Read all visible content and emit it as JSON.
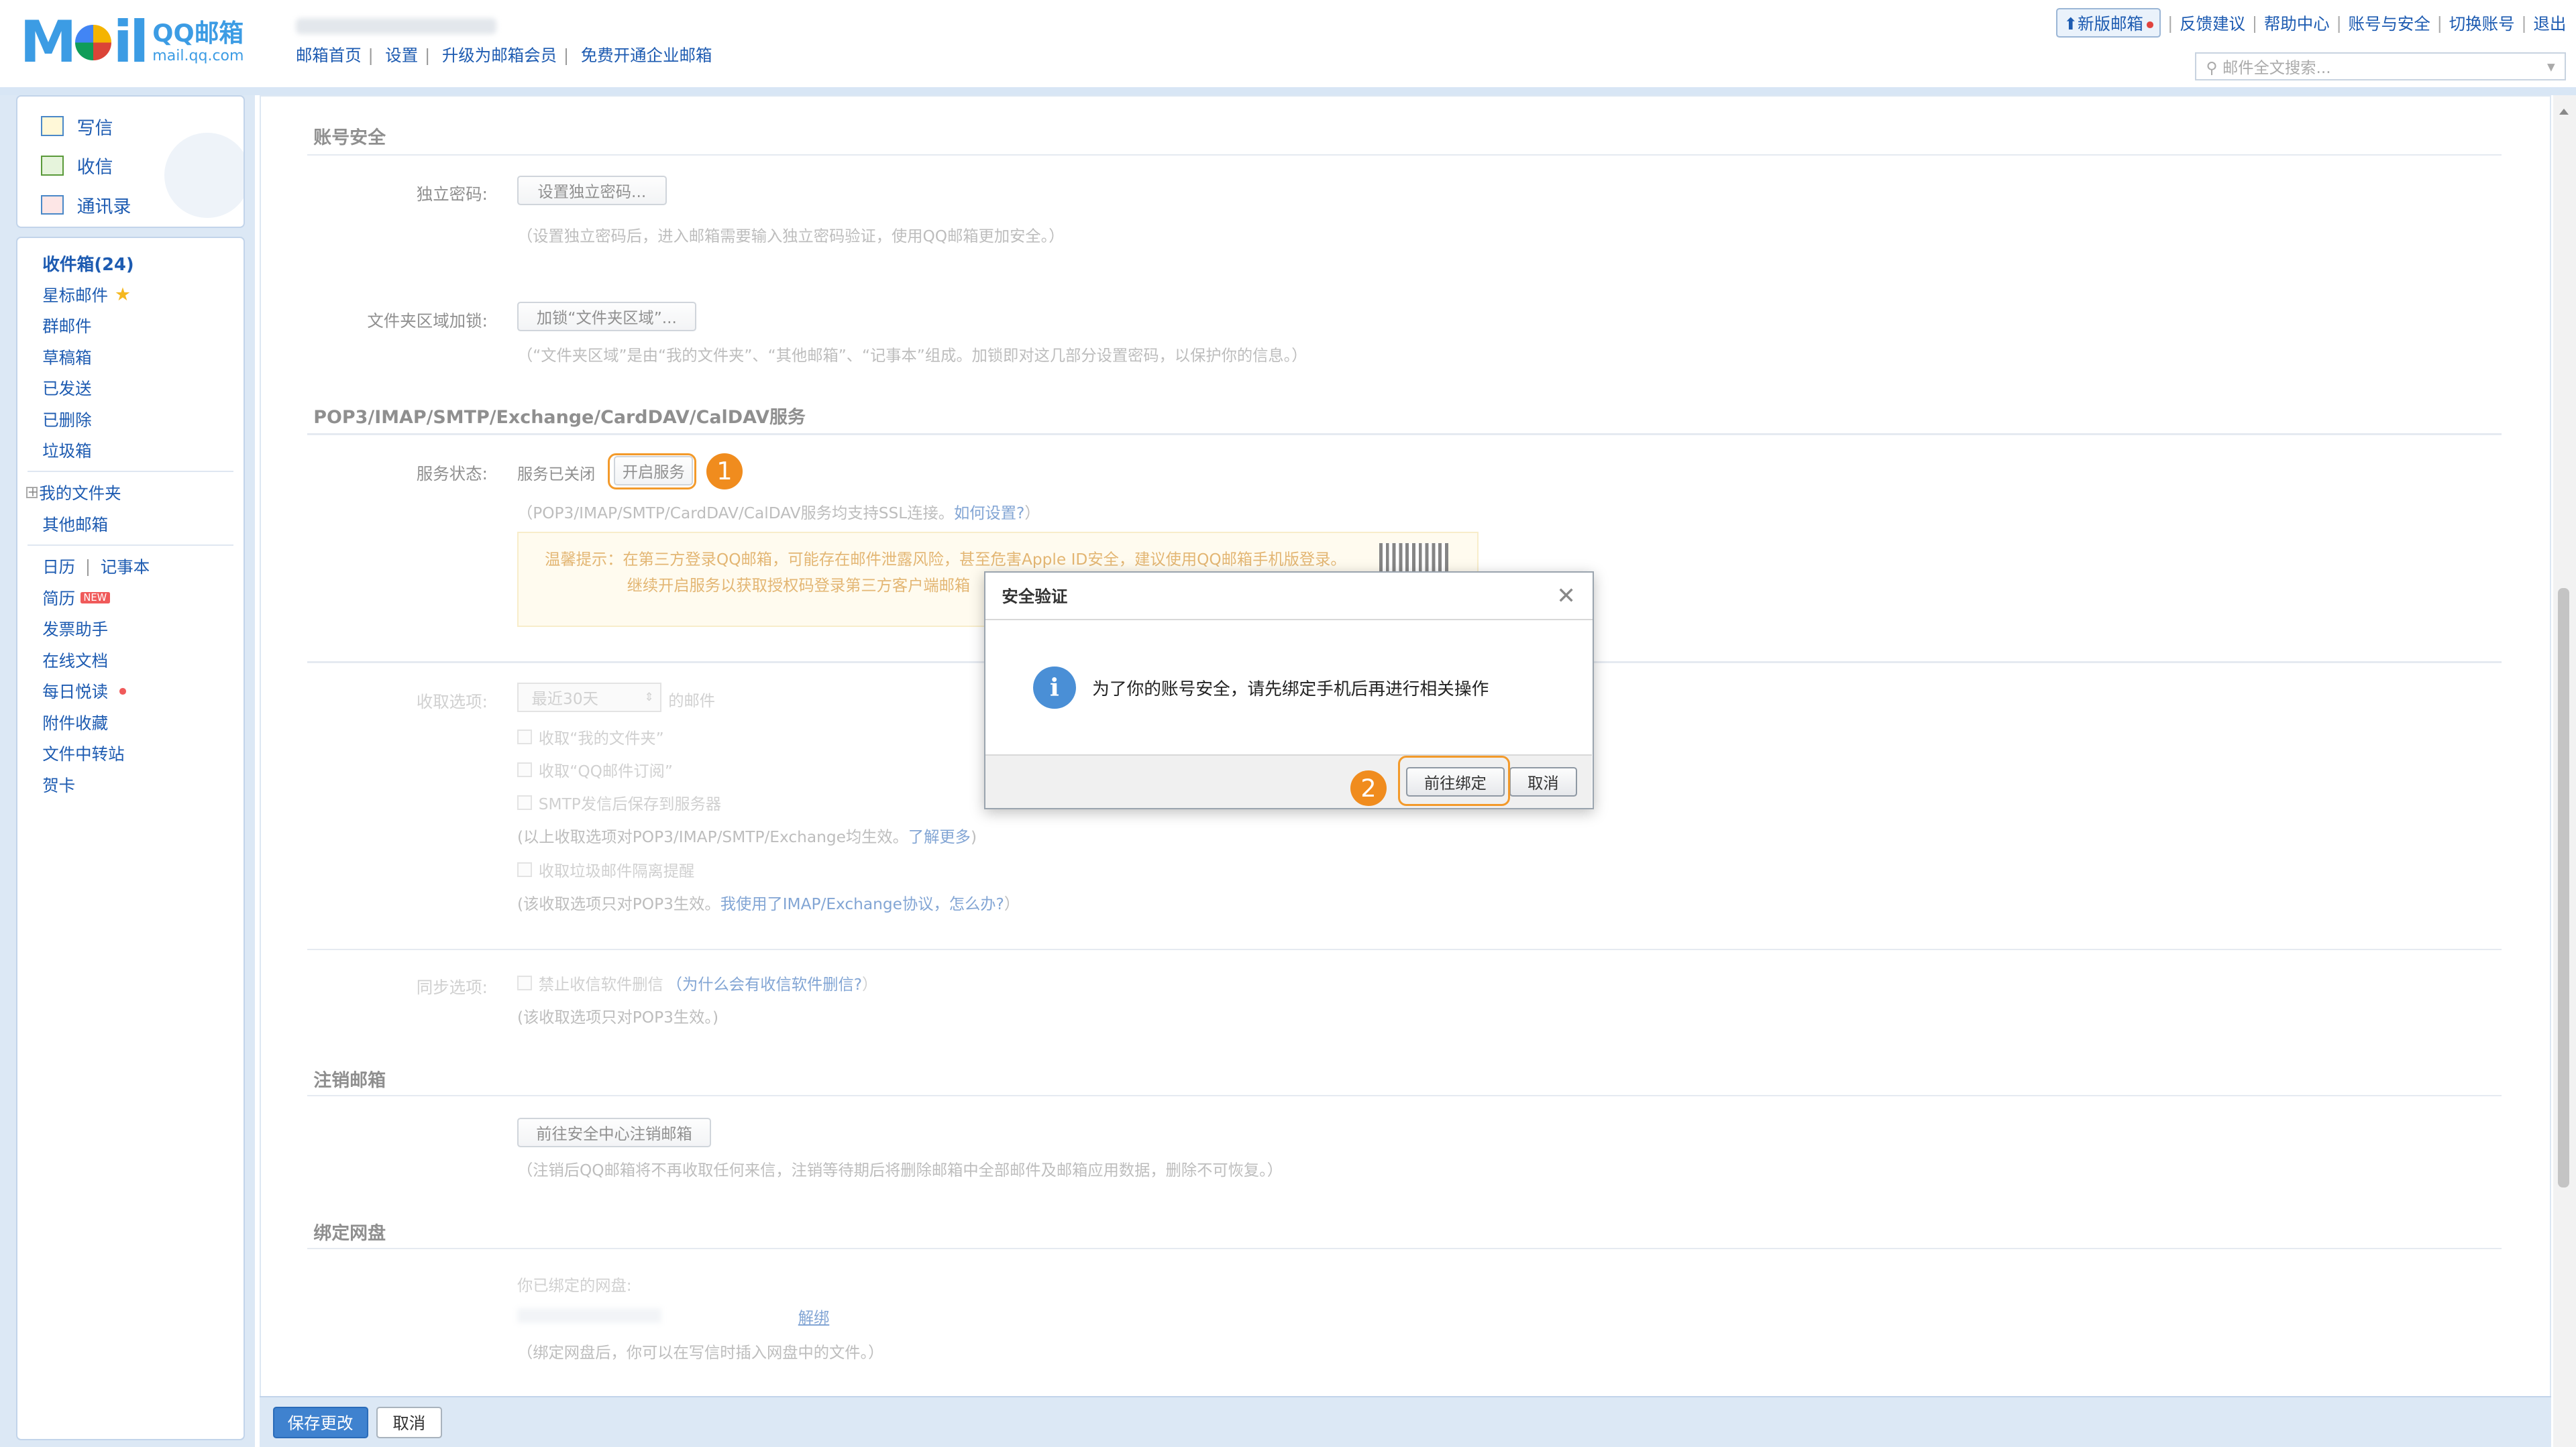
{
  "app": {
    "brand": "QQ邮箱",
    "brand_url": "mail.qq.com"
  },
  "topnav": [
    "邮箱首页",
    "设置",
    "升级为邮箱会员",
    "免费开通企业邮箱"
  ],
  "toplinks": {
    "new_mail": "新版邮箱",
    "items": [
      "反馈建议",
      "帮助中心",
      "账号与安全",
      "切换账号",
      "退出"
    ]
  },
  "search": {
    "placeholder": "邮件全文搜索..."
  },
  "main_actions": [
    "写信",
    "收信",
    "通讯录"
  ],
  "folders": {
    "inbox": "收件箱(24)",
    "starred": "星标邮件",
    "items": [
      "群邮件",
      "草稿箱",
      "已发送",
      "已删除",
      "垃圾箱"
    ],
    "my_folders": "我的文件夹",
    "other_mailbox": "其他邮箱",
    "calendar": "日历",
    "notes": "记事本",
    "resume": "简历",
    "new_badge": "NEW",
    "tools": [
      "发票助手",
      "在线文档",
      "每日悦读",
      "附件收藏",
      "文件中转站",
      "贺卡"
    ]
  },
  "account_security": {
    "title": "账号安全",
    "pwd_label": "独立密码:",
    "pwd_btn": "设置独立密码...",
    "pwd_desc": "（设置独立密码后，进入邮箱需要输入独立密码验证，使用QQ邮箱更加安全。）",
    "folder_label": "文件夹区域加锁:",
    "folder_btn": "加锁“文件夹区域”...",
    "folder_desc": "（“文件夹区域”是由“我的文件夹”、“其他邮箱”、“记事本”组成。加锁即对这几部分设置密码，以保护你的信息。）"
  },
  "pop3": {
    "title": "POP3/IMAP/SMTP/Exchange/CardDAV/CalDAV服务",
    "status_label": "服务状态:",
    "status_value": "服务已关闭",
    "open_btn": "开启服务",
    "ssl_desc": "（POP3/IMAP/SMTP/CardDAV/CalDAV服务均支持SSL连接。",
    "how_link": "如何设置?",
    "close_paren": "）",
    "warn1": "温馨提示：在第三方登录QQ邮箱，可能存在邮件泄露风险，甚至危害Apple ID安全，建议使用QQ邮箱手机版登录。",
    "warn2": "继续开启服务以获取授权码登录第三方客户端邮箱"
  },
  "receive": {
    "label": "收取选项:",
    "select": "最近30天",
    "suffix": "的邮件",
    "opts": [
      "收取“我的文件夹”",
      "收取“QQ邮件订阅”",
      "SMTP发信后保存到服务器"
    ],
    "note1": "(以上收取选项对POP3/IMAP/SMTP/Exchange均生效。",
    "more_link": "了解更多",
    "opt4": "收取垃圾邮件隔离提醒",
    "note2": "(该收取选项只对POP3生效。",
    "imap_link": "我使用了IMAP/Exchange协议，怎么办?",
    "paren": "）"
  },
  "sync": {
    "label": "同步选项:",
    "opt": "禁止收信软件删信",
    "why_link": "（为什么会有收信软件删信?",
    "note": "(该收取选项只对POP3生效。)"
  },
  "cancel_mail": {
    "title": "注销邮箱",
    "btn": "前往安全中心注销邮箱",
    "desc": "（注销后QQ邮箱将不再收取任何来信，注销等待期后将删除邮箱中全部邮件及邮箱应用数据，删除不可恢复。）"
  },
  "netdisk": {
    "title": "绑定网盘",
    "bound": "你已绑定的网盘:",
    "unbind": "解绑",
    "desc": "（绑定网盘后，你可以在写信时插入网盘中的文件。）"
  },
  "bottom": {
    "save": "保存更改",
    "cancel": "取消"
  },
  "dialog": {
    "title": "安全验证",
    "message": "为了你的账号安全，请先绑定手机后再进行相关操作",
    "confirm": "前往绑定",
    "cancel": "取消"
  },
  "annotations": [
    "1",
    "2"
  ]
}
